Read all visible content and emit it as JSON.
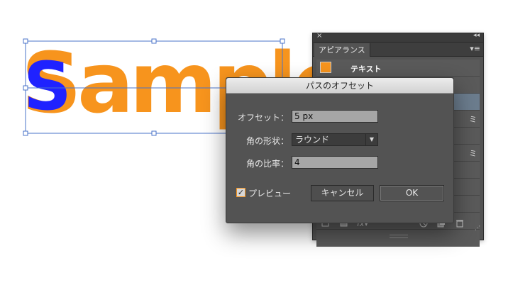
{
  "canvas": {
    "sample_text": "Sample",
    "text_fill": "#f7941d",
    "highlight_letter": "S",
    "highlight_color": "#1f22ff",
    "selection_color": "#4a73c9"
  },
  "appearance_panel": {
    "close_glyph": "×",
    "collapse_glyph": "◂◂",
    "tab_label": "アピアランス",
    "menu_glyph": "▾≡",
    "row_label": "テキスト",
    "row_color": "#f7941d",
    "partial_text": "ミ",
    "footer_icons": [
      "square-outline-icon",
      "square-filled-icon",
      "fx-icon",
      "clear-icon",
      "duplicate-icon",
      "trash-icon"
    ]
  },
  "dialog": {
    "title": "パスのオフセット",
    "offset_label": "オフセット：",
    "offset_value": "5 px",
    "joins_label": "角の形状：",
    "joins_value": "ラウンド",
    "miter_label": "角の比率：",
    "miter_value": "4",
    "preview_label": "プレビュー",
    "preview_checked": true,
    "cancel_label": "キャンセル",
    "ok_label": "OK"
  }
}
